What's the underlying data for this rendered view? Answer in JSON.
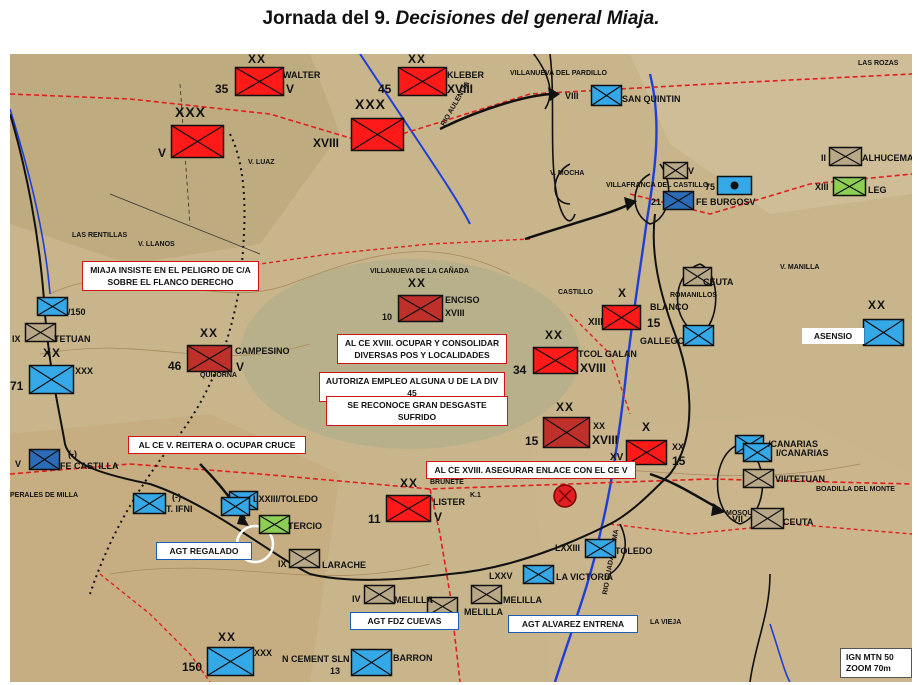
{
  "title": {
    "main": "Jornada del 9. ",
    "italic": "Decisiones del general Miaja."
  },
  "colors": {
    "nationalist": "#ff1a1a",
    "nationalist_dark": "#c0302a",
    "republican": "#35a8e8",
    "republican_dark": "#2a6cb8",
    "moroccan": "#b8a888",
    "legion": "#8ccf54",
    "background_map": "#c9b890"
  },
  "units": {
    "walter": {
      "echelon": "XX",
      "number": "35",
      "name": "WALTER",
      "corps": "V"
    },
    "kleber": {
      "echelon": "XX",
      "number": "45",
      "name": "KLEBER",
      "corps": "XVIII"
    },
    "v_corps": {
      "echelon": "XXX",
      "name": "V"
    },
    "xviii_corps": {
      "echelon": "XXX",
      "name": "XVIII"
    },
    "viii_div": {
      "name": "VIII"
    },
    "san_quintin": {
      "name": "SAN QUINTIN"
    },
    "enciso": {
      "echelon": "XX",
      "number": "10",
      "name": "ENCISO",
      "corps": "XVIII"
    },
    "campesino": {
      "echelon": "XX",
      "number": "46",
      "name": "CAMPESINO",
      "corps": "V"
    },
    "tcol_galan": {
      "echelon": "XX",
      "number": "34",
      "name": "TCOL GALAN",
      "corps": "XVIII"
    },
    "div15": {
      "echelon": "XX",
      "number": "15",
      "name": "XX",
      "corps": "XVIII"
    },
    "lister": {
      "echelon": "XX",
      "number": "11",
      "name": "LISTER",
      "corps": "V"
    },
    "blanco": {
      "echelon": "X",
      "name": "BLANCO",
      "unit": "XIII",
      "number": "15"
    },
    "x15": {
      "echelon": "X",
      "name": "XX",
      "unit": "XV",
      "number": "15"
    },
    "fe_burgos": {
      "number": "21",
      "name": "FE BURGOSV"
    },
    "v_top": {
      "name": "V"
    },
    "ceuta_top": {
      "name": "CEUTA"
    },
    "gallego": {
      "name": "GALLEGO"
    },
    "unit75": {
      "number": "75"
    },
    "alhucemas": {
      "unit": "II",
      "name": "ALHUCEMAS"
    },
    "leg": {
      "unit": "XIII",
      "name": "LEG"
    },
    "asensio": {
      "echelon": "XX",
      "name": "ASENSIO"
    },
    "canarias1": {
      "name": "/CANARIAS"
    },
    "canarias2": {
      "name": "I/CANARIAS"
    },
    "tetuan_right": {
      "name": "VII/TETUAN"
    },
    "ceuta_right": {
      "unit": "VII",
      "name": "CEUTA"
    },
    "left_150": {
      "name": "/150"
    },
    "tetuan_left": {
      "unit": "IX",
      "name": "TETUAN"
    },
    "xxx_left": {
      "echelon": "XX",
      "number": "71",
      "name": "XXX"
    },
    "fe_castilla": {
      "unit": "V",
      "name": "FE CASTILLA",
      "mark": "(-)"
    },
    "ifni": {
      "name": "T. IFNI",
      "mark": "(-)"
    },
    "toledo_left": {
      "name": "LXXIII/TOLEDO"
    },
    "tercio": {
      "name": "TERCIO"
    },
    "larache": {
      "unit": "IX",
      "name": "LARACHE"
    },
    "melilla1": {
      "unit": "IV",
      "name": "MELILLA"
    },
    "melilla2": {
      "unit": "I",
      "name": "MELILLA"
    },
    "melilla3": {
      "name": "MELILLA"
    },
    "lxxiii_toledo": {
      "unit": "LXXIII",
      "name": "TOLEDO"
    },
    "victoria": {
      "unit": "LXXV",
      "name": "LA VICTORIA"
    },
    "barron": {
      "echelon": "XX",
      "number": "150",
      "name": "XXX",
      "unit": "N CEMENT SLN",
      "sub": "13",
      "label": "BARRON"
    }
  },
  "annotations": {
    "miaja": "MIAJA INSISTE EN EL PELIGRO DE C/A SOBRE EL FLANCO DERECHO",
    "ce_xviii_ocupar": "AL CE XVIII. OCUPAR Y CONSOLIDAR DIVERSAS POS Y LOCALIDADES",
    "autoriza": "AUTORIZA EMPLEO ALGUNA U DE LA DIV 45",
    "reconoce": "SE RECONOCE GRAN DESGASTE SUFRIDO",
    "ce_v": "AL CE V. REITERA O. OCUPAR CRUCE",
    "ce_xviii_enlace": "AL CE XVIII. ASEGURAR ENLACE CON EL CE V"
  },
  "groupings": {
    "regalado": "AGT REGALADO",
    "cuevas": "AGT FDZ CUEVAS",
    "alvarez": "AGT ALVAREZ ENTRENA",
    "asensio_box": "ASENSIO"
  },
  "scale": {
    "line1": "IGN MTN 50",
    "line2": "ZOOM 70m"
  },
  "map_labels": {
    "villanueva_pardillo": "VILLANUEVA DEL PARDILLO",
    "villafranca": "VILLAFRANCA DEL CASTILLO",
    "villanueva_canada": "VILLANUEVA DE LA CAÑADA",
    "quijorna": "QUIJORNA",
    "brunete": "BRUNETE",
    "perales": "PERALES DE MILLA",
    "las_rentillas": "LAS RENTILLAS",
    "llanos": "V. LLANOS",
    "mocha": "V. MOCHA",
    "manilla": "V. MANILLA",
    "castillo": "CASTILLO",
    "romanillos": "ROMANILLOS",
    "luaz": "V. LUAZ",
    "vieja": "LA VIEJA",
    "aulencia": "RIO AULENCIA",
    "guadarrama": "RIO GUADARRAMA",
    "mosquito": "MOSQUITO",
    "boadilla": "BOADILLA DEL MONTE",
    "rozas": "LAS ROZAS",
    "brunete_k1": "K.1"
  }
}
